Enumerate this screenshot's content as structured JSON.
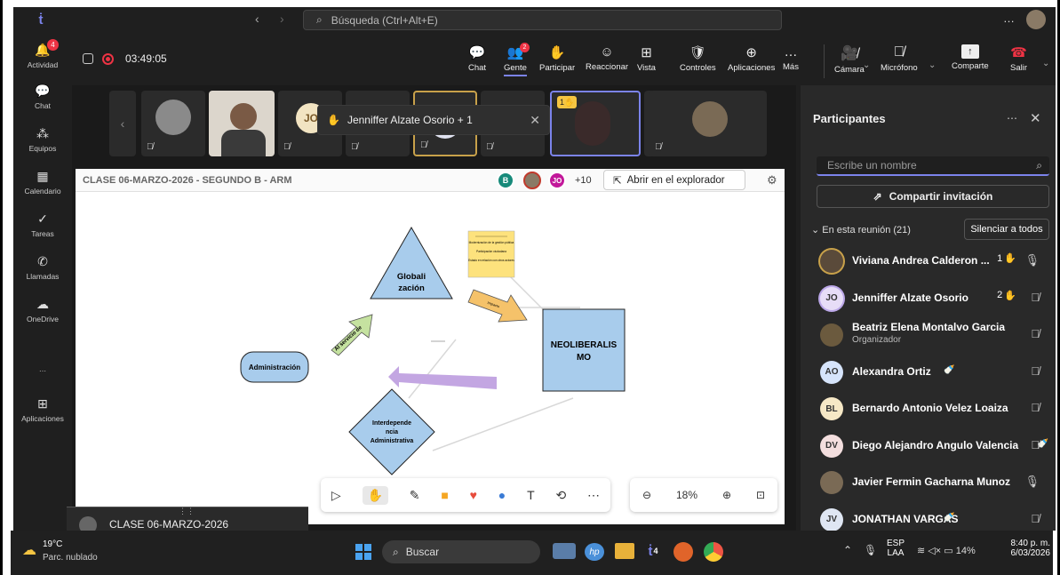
{
  "app": {
    "search_placeholder": "Búsqueda (Ctrl+Alt+E)",
    "more": "…"
  },
  "rail": [
    {
      "label": "Actividad",
      "icon": "bell-icon",
      "badge": "4"
    },
    {
      "label": "Chat",
      "icon": "chat-icon"
    },
    {
      "label": "Equipos",
      "icon": "teams-icon"
    },
    {
      "label": "Calendario",
      "icon": "calendar-icon"
    },
    {
      "label": "Tareas",
      "icon": "tasks-icon"
    },
    {
      "label": "Llamadas",
      "icon": "phone-icon"
    },
    {
      "label": "OneDrive",
      "icon": "cloud-icon"
    },
    {
      "label": "…",
      "icon": "more-icon"
    },
    {
      "label": "Aplicaciones",
      "icon": "apps-icon"
    }
  ],
  "meeting": {
    "timer": "03:49:05",
    "tools": [
      {
        "label": "Chat",
        "glyph": "💬"
      },
      {
        "label": "Gente",
        "glyph": "👥",
        "badge": "2"
      },
      {
        "label": "Participar",
        "glyph": "✋"
      },
      {
        "label": "Reaccionar",
        "glyph": "☺"
      },
      {
        "label": "Vista",
        "glyph": "⊞"
      },
      {
        "label": "Controles",
        "glyph": "🛡"
      },
      {
        "label": "Aplicaciones",
        "glyph": "⊕"
      },
      {
        "label": "Más",
        "glyph": "…"
      }
    ],
    "camera": "Cámara",
    "mic": "Micrófono",
    "share": "Comparte",
    "leave": "Salir"
  },
  "stage": {
    "hand_toast": "Jenniffer Alzate Osorio + 1",
    "tiles": [
      {
        "initials": "JO"
      }
    ],
    "raised_count": "1"
  },
  "whiteboard": {
    "title": "CLASE 06-MARZO-2026 - SEGUNDO B - ARM",
    "avatars": [
      "B",
      "",
      "JO"
    ],
    "more_count": "+10",
    "open_button": "Abrir en el explorador",
    "zoom": "18%",
    "shapes": {
      "triangle": "Globali zación",
      "square": "NEOLIBERALIS MO",
      "rounded": "Administración",
      "diamond": "Interdepende ncia Administrativa",
      "green_arrow": "Al servicio de",
      "orange_arrow": "Impacto",
      "sticky": [
        "Modernización de la gestión pública",
        "Participación ciudadana",
        "Estado en relación con otros actores"
      ]
    }
  },
  "mini_window": {
    "title": "CLASE 06-MARZO-2026"
  },
  "panel": {
    "title": "Participantes",
    "search_placeholder": "Escribe un nombre",
    "share_invite": "Compartir invitación",
    "in_meeting": "En esta reunión (21)",
    "mute_all": "Silenciar a todos",
    "participants": [
      {
        "name": "Viviana Andrea Calderon ...",
        "initials": "",
        "hand": "1",
        "mic": "on",
        "color": "#5a4a3a"
      },
      {
        "name": "Jenniffer Alzate Osorio",
        "initials": "JO",
        "hand": "2",
        "mic": "off",
        "color": "#e7ddf7"
      },
      {
        "name": "Beatriz Elena Montalvo Garcia",
        "sub": "Organizador",
        "initials": "",
        "mic": "off",
        "color": "#6b5a3e"
      },
      {
        "name": "Alexandra Ortiz",
        "initials": "AO",
        "mic": "off",
        "color": "#d6e4fb",
        "extra": "🍼"
      },
      {
        "name": "Bernardo Antonio Velez Loaiza",
        "initials": "BL",
        "mic": "off",
        "color": "#f6e8c6"
      },
      {
        "name": "Diego Alejandro Angulo Valencia",
        "initials": "DV",
        "mic": "off",
        "color": "#f3dede",
        "extra": "🍼"
      },
      {
        "name": "Javier Fermin Gacharna Munoz",
        "initials": "",
        "mic": "on",
        "color": "#7a6a55"
      },
      {
        "name": "JONATHAN VARGAS",
        "initials": "JV",
        "mic": "off",
        "color": "#dfe6f3",
        "extra": "🍼"
      }
    ]
  },
  "taskbar": {
    "temp": "19°C",
    "weather": "Parc. nublado",
    "search": "Buscar",
    "lang1": "ESP",
    "lang2": "LAA",
    "battery": "14%",
    "time": "8:40 p. m.",
    "date": "6/03/2026",
    "teams_badge": "4"
  }
}
